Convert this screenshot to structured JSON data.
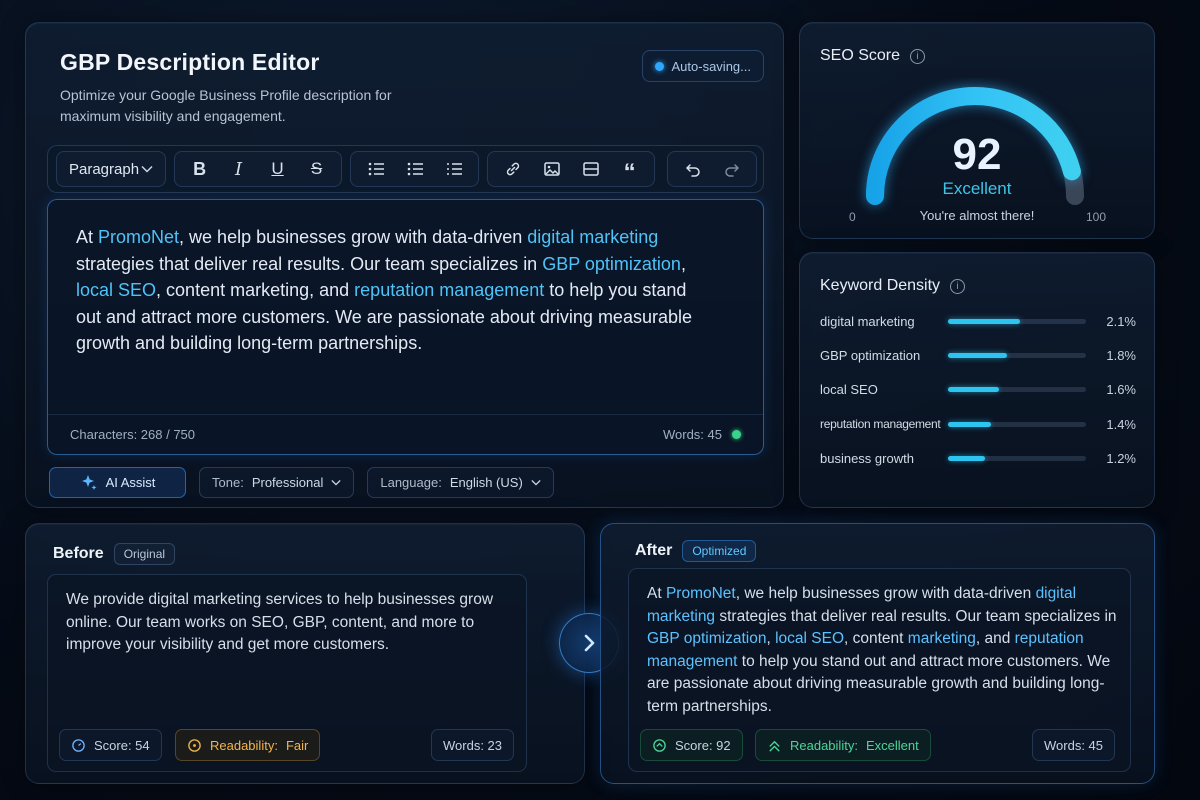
{
  "editor": {
    "title": "GBP Description Editor",
    "subtitle": "Optimize your Google Business Profile description for maximum visibility and engagement.",
    "autosave_label": "Auto-saving...",
    "paragraph_select": "Paragraph",
    "content": {
      "s1": "At ",
      "k1": "PromoNet",
      "s2": ", we help businesses grow with data-driven ",
      "k2": "digital marketing",
      "s3": " strategies that deliver real results. Our team specializes in ",
      "k3": "GBP optimization",
      "s4": ", ",
      "k4": "local SEO",
      "s5": ", content marketing, and ",
      "k5": "reputation management",
      "s6": " to help you stand out and attract more customers. We are passionate about driving measurable growth and building long-term partnerships."
    },
    "characters": "Characters: 268 / 750",
    "words": "Words: 45",
    "ai_assist": "AI Assist",
    "tone_label": "Tone:",
    "tone_value": "Professional",
    "language_label": "Language:",
    "language_value": "English (US)"
  },
  "seo": {
    "title": "SEO Score",
    "score": "92",
    "score_fraction": 0.92,
    "rating": "Excellent",
    "note": "You're almost there!",
    "min": "0",
    "max": "100"
  },
  "keywords": {
    "title": "Keyword Density",
    "items": [
      {
        "name": "digital marketing",
        "value": "2.1%",
        "fill": 0.52
      },
      {
        "name": "GBP optimization",
        "value": "1.8%",
        "fill": 0.43
      },
      {
        "name": "local SEO",
        "value": "1.6%",
        "fill": 0.37
      },
      {
        "name": "reputation management",
        "value": "1.4%",
        "fill": 0.31
      },
      {
        "name": "business growth",
        "value": "1.2%",
        "fill": 0.27
      }
    ]
  },
  "before": {
    "title": "Before",
    "chip": "Original",
    "text": "We provide digital marketing services to help businesses grow online. Our team works on SEO, GBP, content, and more to improve your visibility and get more customers.",
    "score": "Score: 54",
    "readability_label": "Readability:",
    "readability_value": "Fair",
    "words": "Words: 23"
  },
  "after": {
    "title": "After",
    "chip": "Optimized",
    "content": {
      "s1": "At ",
      "k1": "PromoNet",
      "s2": ", we help businesses grow with data-driven ",
      "k2": "digital marketing",
      "s3": " strategies that deliver real results. Our team specializes in ",
      "k3": "GBP optimization",
      "s4": ", ",
      "k4": "local SEO",
      "s5": ", content ",
      "k5": "marketing",
      "s6": ", and ",
      "k6": "reputation management",
      "s7": " to help you stand out and attract more customers. We are passionate about driving measurable growth and building long-term partnerships."
    },
    "score": "Score: 92",
    "readability_label": "Readability:",
    "readability_value": "Excellent",
    "words": "Words: 45"
  },
  "colors": {
    "accent": "#4fc3f7",
    "good": "#4fd49a",
    "warn": "#f2b54a"
  }
}
